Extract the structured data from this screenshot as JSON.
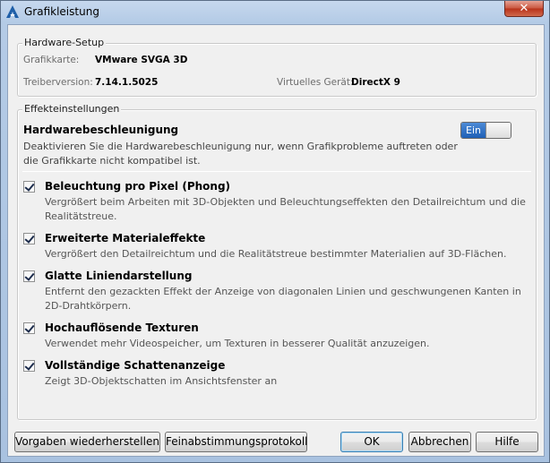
{
  "window": {
    "title": "Grafikleistung",
    "close_label": "✕"
  },
  "hardware": {
    "group_label": "Hardware-Setup",
    "card_label": "Grafikkarte:",
    "card_value": "VMware SVGA 3D",
    "driver_label": "Treiberversion:",
    "driver_value": "7.14.1.5025",
    "device_label": "Virtuelles Gerät:",
    "device_value": "DirectX 9"
  },
  "effects": {
    "group_label": "Effekteinstellungen",
    "accel_title": "Hardwarebeschleunigung",
    "accel_desc": "Deaktivieren Sie die Hardwarebeschleunigung nur, wenn Grafikprobleme auftreten oder die Grafikkarte nicht kompatibel ist.",
    "toggle_label": "Ein",
    "toggle_on": true,
    "options": [
      {
        "title": "Beleuchtung pro Pixel (Phong)",
        "desc": "Vergrößert beim Arbeiten mit 3D-Objekten und Beleuchtungseffekten den Detailreichtum und die Realitätstreue.",
        "checked": true
      },
      {
        "title": "Erweiterte Materialeffekte",
        "desc": "Vergrößert den Detailreichtum und die Realitätstreue bestimmter Materialien auf 3D-Flächen.",
        "checked": true
      },
      {
        "title": "Glatte Liniendarstellung",
        "desc": "Entfernt den gezackten Effekt der Anzeige von diagonalen Linien und geschwungenen Kanten in 2D-Drahtkörpern.",
        "checked": true
      },
      {
        "title": "Hochauflösende Texturen",
        "desc": "Verwendet mehr Videospeicher, um Texturen in besserer Qualität anzuzeigen.",
        "checked": true
      },
      {
        "title": "Vollständige Schattenanzeige",
        "desc": "Zeigt 3D-Objektschatten im Ansichtsfenster an",
        "checked": true
      }
    ]
  },
  "buttons": {
    "restore": "Vorgaben wiederherstellen",
    "log": "Feinabstimmungsprotokoll",
    "ok": "OK",
    "cancel": "Abbrechen",
    "help": "Hilfe"
  },
  "colors": {
    "toggle_accent": "#1e5fb6",
    "close_button": "#c9553e"
  }
}
